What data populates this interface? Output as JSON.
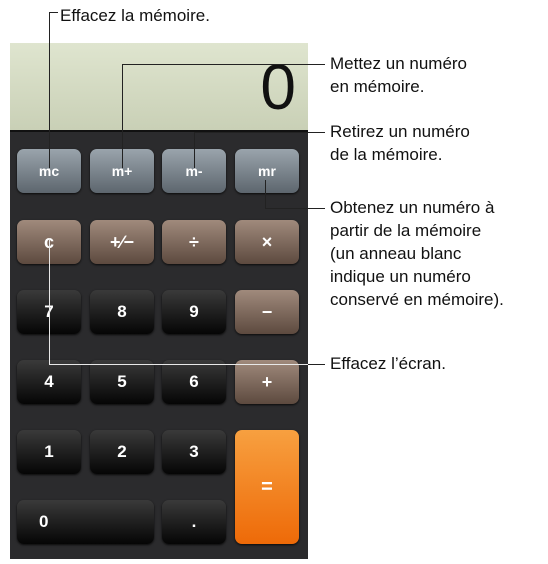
{
  "callouts": {
    "clear_memory": "Effacez la mémoire.",
    "memory_add": "Mettez un numéro\nen mémoire.",
    "memory_subtract": "Retirez un numéro\nde la mémoire.",
    "memory_recall": "Obtenez un numéro à\npartir de la mémoire\n(un anneau blanc\nindique un numéro\nconservé en mémoire).",
    "clear_screen": "Effacez l’écran."
  },
  "display": {
    "value": "0"
  },
  "keys": {
    "mc": "mc",
    "mplus": "m+",
    "mminus": "m-",
    "mr": "mr",
    "c": "c",
    "plusminus": "+∕−",
    "divide": "÷",
    "multiply": "×",
    "seven": "7",
    "eight": "8",
    "nine": "9",
    "minus": "−",
    "four": "4",
    "five": "5",
    "six": "6",
    "plus": "+",
    "one": "1",
    "two": "2",
    "three": "3",
    "zero": "0",
    "decimal": ".",
    "equals": "="
  },
  "colors": {
    "memory_key": "#7b858d",
    "function_key": "#7d6a5e",
    "number_key": "#1e1e1e",
    "equals_key": "#f28424",
    "display": "#d5dbc3"
  }
}
